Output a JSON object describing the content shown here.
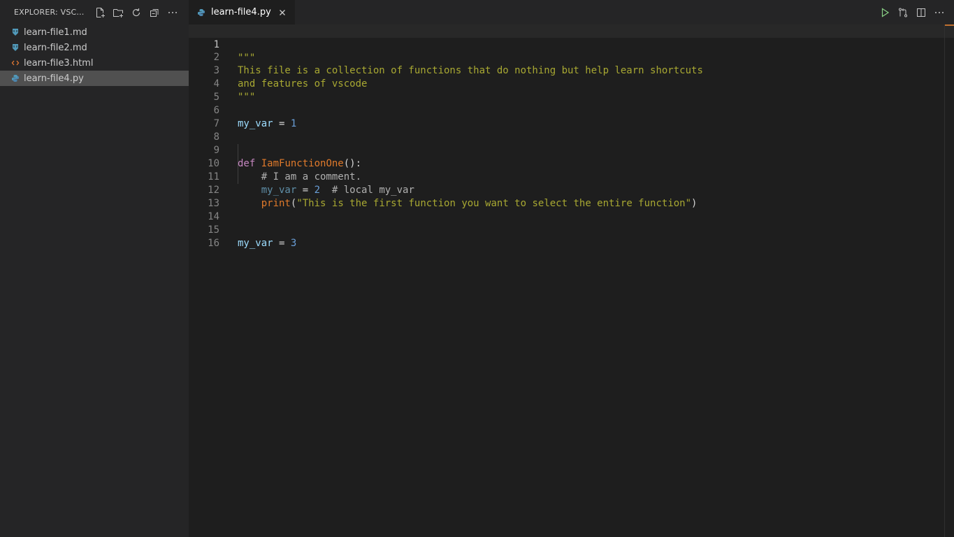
{
  "sidebar": {
    "title": "EXPLORER: VSCO...",
    "actions": [
      {
        "name": "new-file-icon"
      },
      {
        "name": "new-folder-icon"
      },
      {
        "name": "refresh-icon"
      },
      {
        "name": "collapse-all-icon"
      },
      {
        "name": "more-actions-icon"
      }
    ],
    "files": [
      {
        "label": "learn-file1.md",
        "icon": "markdown-icon",
        "icon_color": "#519aba"
      },
      {
        "label": "learn-file2.md",
        "icon": "markdown-icon",
        "icon_color": "#519aba"
      },
      {
        "label": "learn-file3.html",
        "icon": "html-icon",
        "icon_color": "#e37933"
      },
      {
        "label": "learn-file4.py",
        "icon": "python-icon",
        "icon_color": "#519aba"
      }
    ],
    "selected_file": "learn-file4.py"
  },
  "tabs": [
    {
      "label": "learn-file4.py",
      "icon": "python-icon",
      "active": true
    }
  ],
  "editor_actions": [
    {
      "name": "run-icon"
    },
    {
      "name": "open-changes-icon"
    },
    {
      "name": "split-editor-icon"
    },
    {
      "name": "more-actions-icon"
    }
  ],
  "editor": {
    "line_numbers": [
      "1",
      "2",
      "3",
      "4",
      "5",
      "6",
      "7",
      "8",
      "9",
      "10",
      "11",
      "12",
      "13",
      "14",
      "15",
      "16"
    ],
    "current_line": 1,
    "lines": {
      "l1": "\"\"\"",
      "l2": "This file is a collection of functions that do nothing but help learn shortcuts",
      "l3": "and features of vscode",
      "l4": "\"\"\"",
      "l6_var": "my_var",
      "l6_op": " = ",
      "l6_num": "1",
      "l9_kw": "def",
      "l9_fn": "IamFunctionOne",
      "l9_rest": "():",
      "l10": "# I am a comment.",
      "l11_var": "my_var",
      "l11_op": " = ",
      "l11_num": "2",
      "l11_com": "  # local my_var",
      "l12_fn": "print",
      "l12_open": "(",
      "l12_str": "\"This is the first function you want to select the entire function\"",
      "l12_close": ")",
      "l15_var": "my_var",
      "l15_op": " = ",
      "l15_num": "3"
    }
  },
  "colors": {
    "accent_scroll": "#c07030",
    "sidebar_bg": "#252526",
    "editor_bg": "#1e1e1e"
  }
}
